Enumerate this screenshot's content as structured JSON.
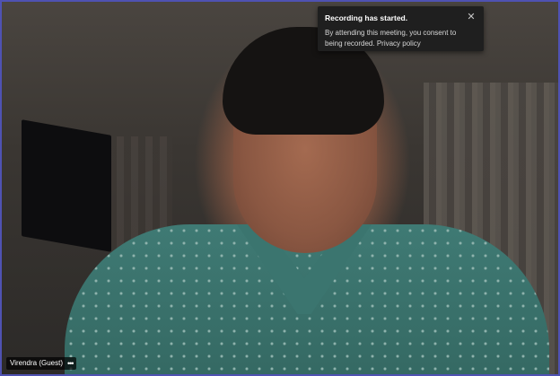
{
  "notification": {
    "title": "Recording has started.",
    "body": "By attending this meeting, you consent to being recorded. Privacy policy",
    "close_icon": "close-icon"
  },
  "participant": {
    "name": "Virendra (Guest)",
    "more_icon": "more-options-icon"
  },
  "colors": {
    "frame_border": "#4f52b2",
    "toast_bg": "#1f1f1f"
  }
}
